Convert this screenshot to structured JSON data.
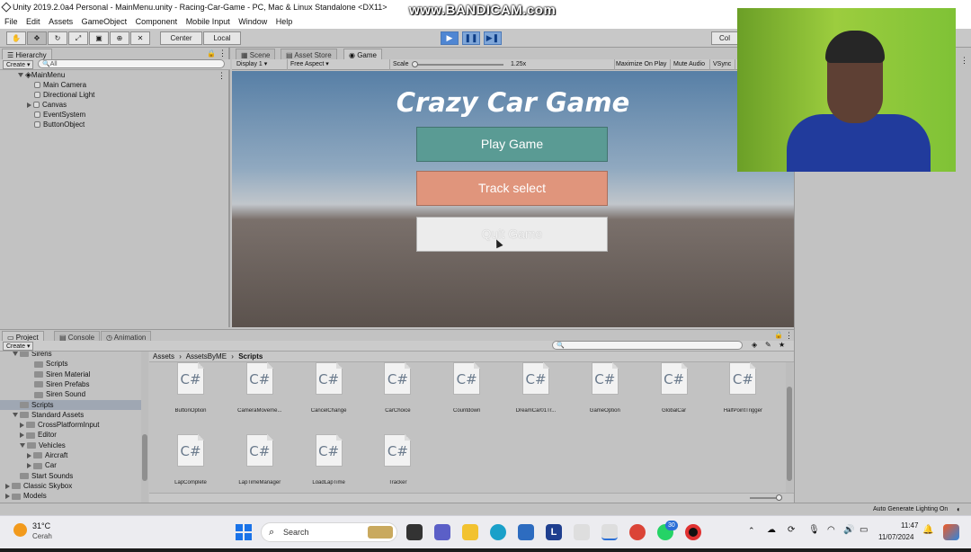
{
  "window": {
    "title": "Unity 2019.2.0a4 Personal - MainMenu.unity - Racing-Car-Game - PC, Mac & Linux Standalone <DX11>",
    "watermark": "www.BANDICAM.com"
  },
  "menubar": {
    "items": [
      "File",
      "Edit",
      "Assets",
      "GameObject",
      "Component",
      "Mobile Input",
      "Window",
      "Help"
    ]
  },
  "toolbar": {
    "center_label": "Center",
    "local_label": "Local",
    "collab_label": "Col"
  },
  "hierarchy": {
    "tab_label": "Hierarchy",
    "create_label": "Create",
    "search_placeholder": "All",
    "scene_name": "MainMenu",
    "items": [
      "Main Camera",
      "Directional Light",
      "Canvas",
      "EventSystem",
      "ButtonObject"
    ]
  },
  "center_tabs": {
    "scene": "Scene",
    "asset_store": "Asset Store",
    "game": "Game"
  },
  "game_toolbar": {
    "display": "Display 1",
    "aspect": "Free Aspect",
    "scale_label": "Scale",
    "scale_value": "1.25x",
    "maximize": "Maximize On Play",
    "mute": "Mute Audio",
    "vsync": "VSync"
  },
  "game_view": {
    "title": "Crazy Car Game",
    "buttons": [
      {
        "label": "Play Game",
        "color": "#5a9b94"
      },
      {
        "label": "Track select",
        "color": "#e0957c"
      },
      {
        "label": "Quit Game",
        "color": "#ececec"
      }
    ]
  },
  "project": {
    "tabs": [
      "Project",
      "Console",
      "Animation"
    ],
    "create_label": "Create",
    "tree": [
      {
        "label": "Sirens",
        "indent": 1,
        "type": "folder"
      },
      {
        "label": "Scripts",
        "indent": 3,
        "type": "folder"
      },
      {
        "label": "Siren Material",
        "indent": 3,
        "type": "folder"
      },
      {
        "label": "Siren Prefabs",
        "indent": 3,
        "type": "folder"
      },
      {
        "label": "Siren Sound",
        "indent": 3,
        "type": "folder"
      },
      {
        "label": "Scripts",
        "indent": 1,
        "type": "folder",
        "selected": true
      },
      {
        "label": "Standard Assets",
        "indent": 1,
        "type": "folder"
      },
      {
        "label": "CrossPlatformInput",
        "indent": 2,
        "type": "folder"
      },
      {
        "label": "Editor",
        "indent": 2,
        "type": "folder"
      },
      {
        "label": "Vehicles",
        "indent": 2,
        "type": "folder"
      },
      {
        "label": "Aircraft",
        "indent": 3,
        "type": "folder"
      },
      {
        "label": "Car",
        "indent": 3,
        "type": "folder"
      },
      {
        "label": "Start Sounds",
        "indent": 1,
        "type": "folder"
      },
      {
        "label": "Classic Skybox",
        "indent": 0,
        "type": "folder"
      },
      {
        "label": "Models",
        "indent": 0,
        "type": "folder"
      }
    ],
    "breadcrumb": [
      "Assets",
      "AssetsByME",
      "Scripts"
    ],
    "file_icon_text": "C#",
    "assets": [
      "ButtonOption",
      "CameraMoveme...",
      "CancelChange",
      "CarChoice",
      "Countdown",
      "DreamCar01Tr...",
      "GameOption",
      "GlobalCar",
      "HalfPointTrigger",
      "LapComplete",
      "LapTimeManager",
      "LoadLapTime",
      "Tracker"
    ]
  },
  "statusbar": {
    "right_text": "Auto Generate Lighting On"
  },
  "taskbar": {
    "weather_temp": "31°C",
    "weather_desc": "Cerah",
    "search_label": "Search",
    "badge_count": "30",
    "time": "11:47",
    "date": "11/07/2024"
  }
}
